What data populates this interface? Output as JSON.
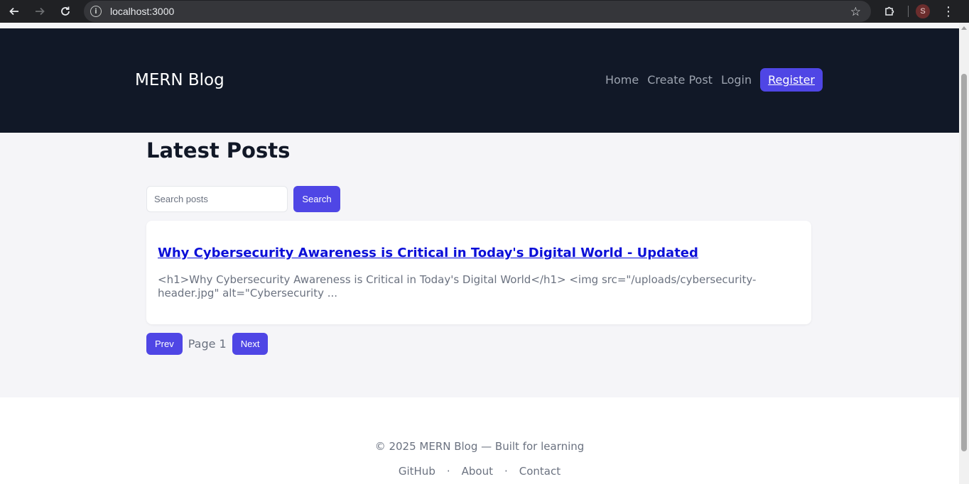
{
  "browser": {
    "url": "localhost:3000",
    "profile_initial": "S"
  },
  "header": {
    "brand": "MERN Blog",
    "nav": {
      "home": "Home",
      "create_post": "Create Post",
      "login": "Login",
      "register": "Register"
    }
  },
  "main": {
    "title": "Latest Posts",
    "search": {
      "placeholder": "Search posts",
      "value": "",
      "button": "Search"
    },
    "posts": [
      {
        "title": "Why Cybersecurity Awareness is Critical in Today's Digital World - Updated",
        "excerpt": "<h1>Why Cybersecurity Awareness is Critical in Today's Digital World</h1> <img src=\"/uploads/cybersecurity-header.jpg\" alt=\"Cybersecurity ..."
      }
    ],
    "pagination": {
      "prev": "Prev",
      "label": "Page 1",
      "next": "Next"
    }
  },
  "footer": {
    "copyright": "© 2025 MERN Blog — Built for learning",
    "links": [
      "GitHub",
      "About",
      "Contact"
    ],
    "separator": "·"
  },
  "colors": {
    "header_bg": "#111827",
    "accent": "#4f46e5",
    "page_bg": "#f5f5f8"
  },
  "icons": {
    "back": "arrow-left-icon",
    "forward": "arrow-right-icon",
    "reload": "reload-icon",
    "site_info": "info-icon",
    "bookmark": "star-icon",
    "extensions": "puzzle-icon",
    "menu": "kebab-menu-icon"
  }
}
